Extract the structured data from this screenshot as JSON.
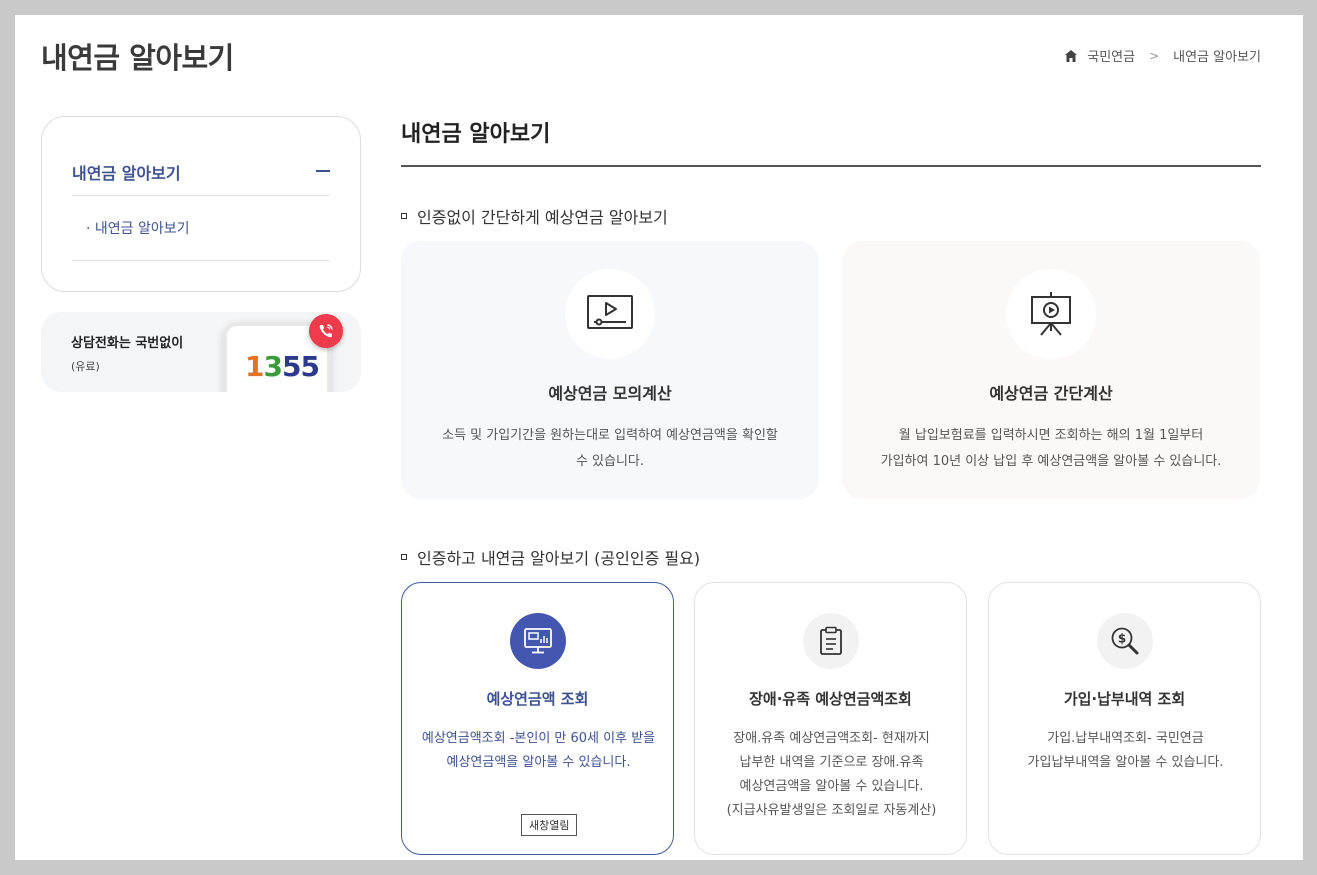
{
  "header": {
    "title": "내연금 알아보기"
  },
  "breadcrumb": {
    "home_icon": "home-icon",
    "item1": "국민연금",
    "separator": ">",
    "item2": "내연금 알아보기"
  },
  "sidebar": {
    "heading": "내연금 알아보기",
    "sub_item": "· 내연금 알아보기"
  },
  "phone": {
    "line1": "상담전화는 국번없이",
    "line2": "(유료)",
    "digit1": "1",
    "digit2": "3",
    "digit3": "5",
    "digit4": "5"
  },
  "main": {
    "title": "내연금 알아보기",
    "section1": {
      "title": "인증없이 간단하게 예상연금 알아보기",
      "cards": [
        {
          "title": "예상연금 모의계산",
          "desc1": "소득 및 가입기간을 원하는대로 입력하여 예상연금액을 확인할",
          "desc2": "수 있습니다.",
          "icon": "video-player-icon"
        },
        {
          "title": "예상연금 간단계산",
          "desc1": "월 납입보험료를 입력하시면 조회하는 해의 1월 1일부터",
          "desc2": "가입하여 10년 이상 납입 후 예상연금액을 알아볼 수 있습니다.",
          "icon": "presentation-play-icon"
        }
      ]
    },
    "section2": {
      "title": "인증하고 내연금 알아보기 (공인인증 필요)",
      "cards": [
        {
          "title": "예상연금액 조회",
          "desc1": "예상연금액조회 -본인이 만 60세 이후 받을",
          "desc2": "예상연금액을 알아볼 수 있습니다.",
          "button": "새창열림",
          "icon": "monitor-chart-icon"
        },
        {
          "title": "장애·유족 예상연금액조회",
          "desc1": "장애.유족 예상연금액조회- 현재까지",
          "desc2": "납부한 내역을 기준으로 장애.유족",
          "desc3": "예상연금액을 알아볼 수 있습니다.",
          "desc4": "(지급사유발생일은 조회일로 자동계산)",
          "icon": "clipboard-icon"
        },
        {
          "title": "가입·납부내역 조회",
          "desc1": "가입.납부내역조회- 국민연금",
          "desc2": "가입납부내역을 알아볼 수 있습니다.",
          "icon": "money-search-icon"
        }
      ]
    }
  },
  "colors": {
    "brand": "#3d5290",
    "accent": "#4356b0",
    "call": "#ef3b4b"
  }
}
